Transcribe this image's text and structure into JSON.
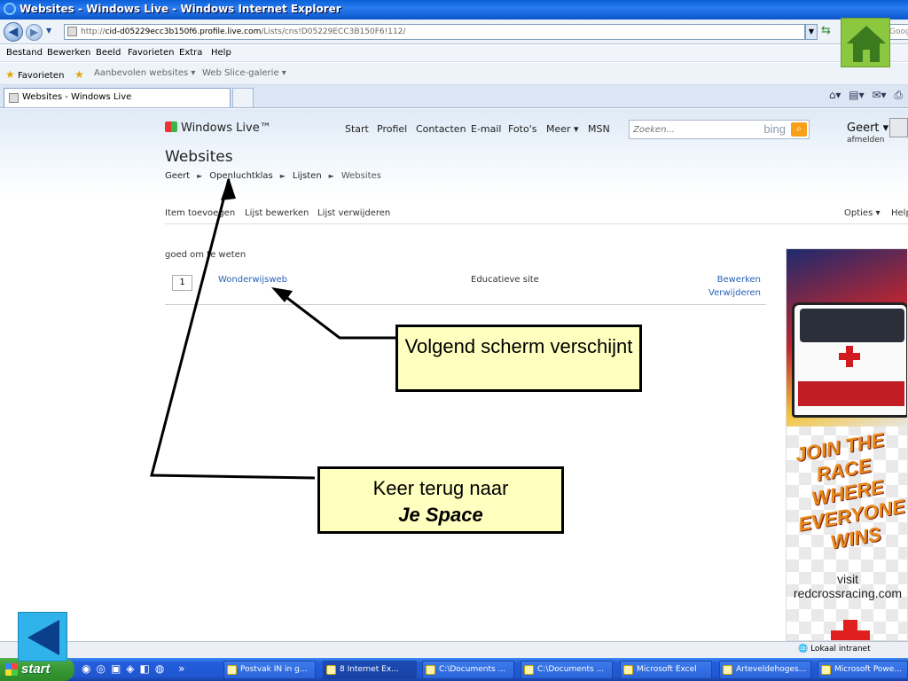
{
  "window": {
    "title": "Websites - Windows Live - Windows Internet Explorer"
  },
  "address": {
    "prefix": "http://",
    "host": "cid-d05229ecc3b150f6.profile.live.com",
    "path": "/Lists/cns!D05229ECC3B150F6!112/",
    "search_placeholder": "Google"
  },
  "menu": [
    "Bestand",
    "Bewerken",
    "Beeld",
    "Favorieten",
    "Extra",
    "Help"
  ],
  "favorites_bar": {
    "favorites": "Favorieten",
    "suggested": "Aanbevolen websites ▾",
    "webslice": "Web Slice-galerie ▾"
  },
  "tab": {
    "title": "Websites - Windows Live"
  },
  "wl": {
    "logo": "Windows Live™",
    "nav": [
      "Start",
      "Profiel",
      "Contacten",
      "E-mail",
      "Foto's",
      "Meer ▾",
      "MSN"
    ],
    "search_placeholder": "Zoeken...",
    "search_brand": "bing",
    "user": "Geert ▾",
    "signout": "afmelden"
  },
  "page": {
    "title": "Websites",
    "breadcrumb": [
      "Geert",
      "Openluchtklas",
      "Lijsten",
      "Websites"
    ],
    "toolbar": {
      "add": "Item toevoegen",
      "edit": "Lijst bewerken",
      "delete": "Lijst verwijderen",
      "options": "Opties ▾",
      "help": "Help"
    },
    "list_title": "goed om te weten",
    "rows": [
      {
        "num": "1",
        "name": "Wonderwijsweb",
        "description": "Educatieve site",
        "edit": "Bewerken",
        "remove": "Verwijderen"
      }
    ]
  },
  "ad": {
    "slogan": "JOIN THE RACE\nWHERE\nEVERYONE WINS",
    "visit": "visit\nredcrossracing.com"
  },
  "callouts": {
    "next_screen": "Volgend scherm verschijnt",
    "back_line1": "Keer terug naar",
    "back_line2": "Je Space"
  },
  "status": {
    "zone": "Lokaal intranet"
  },
  "taskbar": {
    "start": "start",
    "tasks": [
      "Postvak IN in g...",
      "8 Internet Ex...",
      "C:\\Documents ...",
      "C:\\Documents ...",
      "Microsoft Excel",
      "Arteveldehoges...",
      "Microsoft Powe..."
    ]
  },
  "colors": {
    "link": "#2762b8",
    "callout_bg": "#ffffc0",
    "home_green": "#8bc83f",
    "back_blue": "#2fb3ea"
  }
}
